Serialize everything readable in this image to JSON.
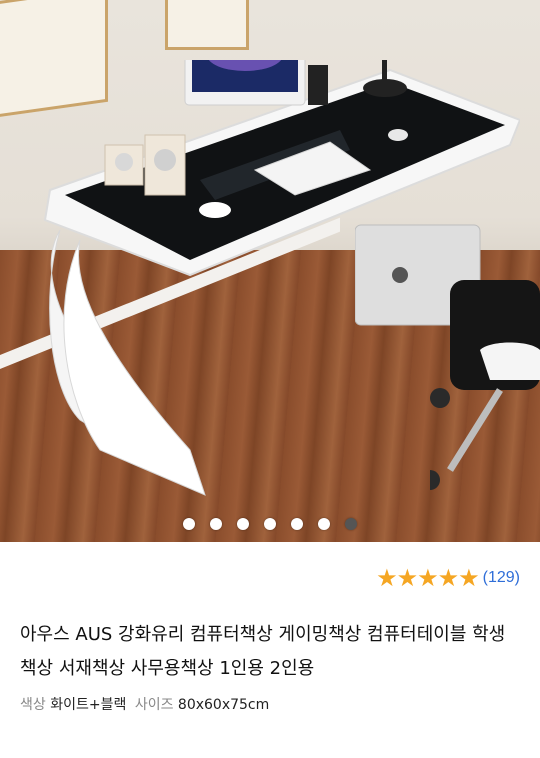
{
  "gallery": {
    "image_alt": "Glass computer desk product photo",
    "dot_count": 7,
    "active_index": 6
  },
  "rating": {
    "stars": 5,
    "review_count": "(129)",
    "star_color": "#f5a623",
    "count_color": "#2f6ed8"
  },
  "product": {
    "title": "아우스 AUS 강화유리 컴퓨터책상 게이밍책상 컴퓨터테이블 학생책상 서재책상 사무용책상 1인용 2인용"
  },
  "options": {
    "color_label": "색상",
    "color_value": "화이트+블랙",
    "size_label": "사이즈",
    "size_value": "80x60x75cm"
  }
}
